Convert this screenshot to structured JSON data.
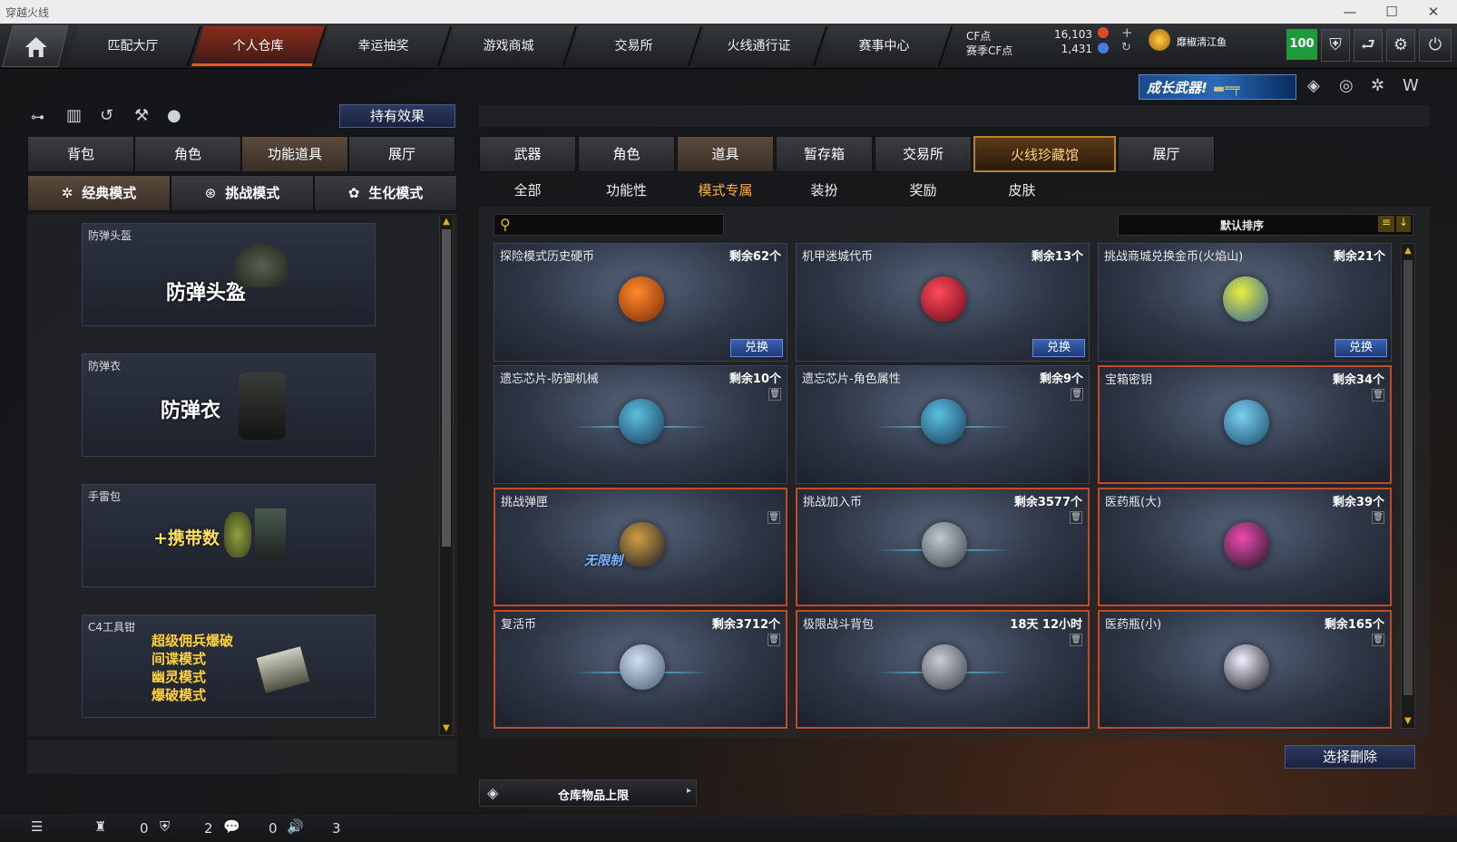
{
  "window": {
    "title": "穿越火线",
    "controls": [
      "—",
      "☐",
      "✕"
    ]
  },
  "nav": {
    "tabs": [
      "匹配大厅",
      "个人仓库",
      "幸运抽奖",
      "游戏商城",
      "交易所",
      "火线通行证",
      "赛事中心"
    ],
    "active_index": 1,
    "cf_label": "CF点",
    "cf_value": "16,103",
    "season_label": "赛季CF点",
    "season_value": "1,431",
    "username": "靡椒淸江鱼",
    "level": "100"
  },
  "banner": {
    "text": "成长武器!"
  },
  "left": {
    "hold_effect_label": "持有效果",
    "tabs": [
      "背包",
      "角色",
      "功能道具",
      "展厅"
    ],
    "tabs_selected": 2,
    "modes": [
      "经典模式",
      "挑战模式",
      "生化模式"
    ],
    "modes_selected": 0,
    "items": [
      {
        "title": "防弹头盔",
        "big": "防弹头盔"
      },
      {
        "title": "防弹衣",
        "big": "防弹衣"
      },
      {
        "title": "手雷包",
        "big": "+携带数"
      },
      {
        "title": "C4工具钳",
        "lines": [
          "超级佣兵爆破",
          "间谍模式",
          "幽灵模式",
          "爆破模式"
        ]
      }
    ]
  },
  "right": {
    "tabs": [
      "武器",
      "角色",
      "道具",
      "暂存箱",
      "交易所",
      "火线珍藏馆",
      "展厅"
    ],
    "tabs_selected": 2,
    "tabs_highlight": 5,
    "subtabs": [
      "全部",
      "功能性",
      "模式专属",
      "装扮",
      "奖励",
      "皮肤"
    ],
    "subtabs_selected": 2,
    "search": {
      "placeholder": "",
      "value": ""
    },
    "sort_label": "默认排序",
    "exchange_label": "兑换",
    "items": [
      {
        "name": "探险模式历史硬币",
        "qty": "剩余62个",
        "exchange": true,
        "red": false,
        "icon": "pulse-coin-icon"
      },
      {
        "name": "机甲迷城代币",
        "qty": "剩余13个",
        "exchange": true,
        "red": false,
        "icon": "mecha-token-icon"
      },
      {
        "name": "挑战商城兑换金币(火焰山)",
        "qty": "剩余21个",
        "exchange": true,
        "red": false,
        "icon": "gold-coin-icon"
      },
      {
        "name": "遗忘芯片-防御机械",
        "qty": "剩余10个",
        "exchange": false,
        "red": false,
        "icon": "chip-defense-icon"
      },
      {
        "name": "遗忘芯片-角色属性",
        "qty": "剩余9个",
        "exchange": false,
        "red": false,
        "icon": "chip-character-icon"
      },
      {
        "name": "宝箱密钥",
        "qty": "剩余34个",
        "exchange": false,
        "red": true,
        "icon": "chest-key-icon"
      },
      {
        "name": "挑战弹匣",
        "qty": "",
        "exchange": false,
        "red": true,
        "icon": "ammo-clip-icon",
        "badge": "无限制"
      },
      {
        "name": "挑战加入币",
        "qty": "剩余3577个",
        "exchange": false,
        "red": true,
        "icon": "join-coin-icon"
      },
      {
        "name": "医药瓶(大)",
        "qty": "剩余39个",
        "exchange": false,
        "red": true,
        "icon": "medkit-large-icon"
      },
      {
        "name": "复活币",
        "qty": "剩余3712个",
        "exchange": false,
        "red": true,
        "icon": "revive-coin-icon"
      },
      {
        "name": "极限战斗背包",
        "qty": "18天 12小时",
        "exchange": false,
        "red": true,
        "icon": "battle-bag-icon"
      },
      {
        "name": "医药瓶(小)",
        "qty": "剩余165个",
        "exchange": false,
        "red": true,
        "icon": "medkit-small-icon"
      }
    ],
    "select_delete_label": "选择删除",
    "capacity_label": "仓库物品上限"
  },
  "status": {
    "counts": [
      "0",
      "2",
      "0",
      "3"
    ]
  }
}
